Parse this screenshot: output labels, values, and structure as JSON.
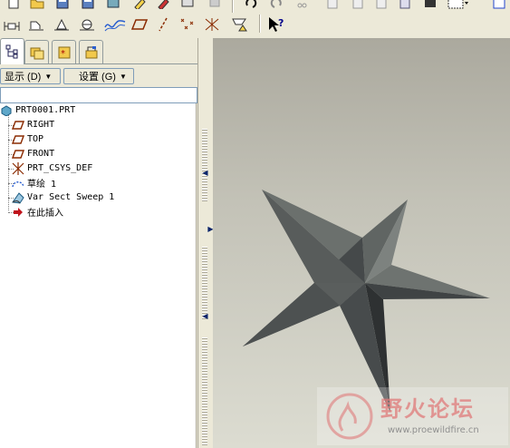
{
  "toolbar": {
    "row1_icons": [
      "new-icon",
      "open-icon",
      "save-icon",
      "save-copy-icon",
      "print-icon",
      "highlight-icon",
      "send-mail-icon",
      "printer-icon",
      "undo-icon",
      "redo-icon",
      "cut-icon",
      "copy-icon",
      "paste-icon",
      "paste-special-icon",
      "regenerate-icon",
      "datum-display-icon",
      "selection-box-icon",
      "help-icon"
    ],
    "row2_icons": [
      "refit-icon",
      "zoom-in-icon",
      "zoom-out-icon",
      "reorient-icon",
      "view-manager-icon",
      "datum-plane-display-icon",
      "datum-axis-display-icon",
      "datum-point-display-icon",
      "csys-display-icon",
      "annotation-display-icon",
      "context-help-icon"
    ]
  },
  "panel": {
    "tabs": [
      "model-tree-tab",
      "folder-browser-tab",
      "favorites-tab",
      "connections-tab"
    ],
    "show_label": "显示 (D)",
    "settings_label": "设置 (G)"
  },
  "tree": {
    "root": "PRT0001.PRT",
    "items": [
      {
        "label": "RIGHT",
        "icon": "datum-plane-icon"
      },
      {
        "label": "TOP",
        "icon": "datum-plane-icon"
      },
      {
        "label": "FRONT",
        "icon": "datum-plane-icon"
      },
      {
        "label": "PRT_CSYS_DEF",
        "icon": "coordinate-system-icon"
      },
      {
        "label": "草绘 1",
        "icon": "sketch-icon"
      },
      {
        "label": "Var Sect Sweep 1",
        "icon": "variable-section-sweep-icon"
      },
      {
        "label": "在此插入",
        "icon": "insert-here-arrow-icon"
      }
    ]
  },
  "watermark": {
    "title": "野火论坛",
    "url": "www.proewildfire.cn"
  },
  "colors": {
    "viewport_top": "#aba99e",
    "viewport_bottom": "#dcdcd1",
    "star_face": "#5a5e5c",
    "watermark_red": "#e07a7a"
  }
}
